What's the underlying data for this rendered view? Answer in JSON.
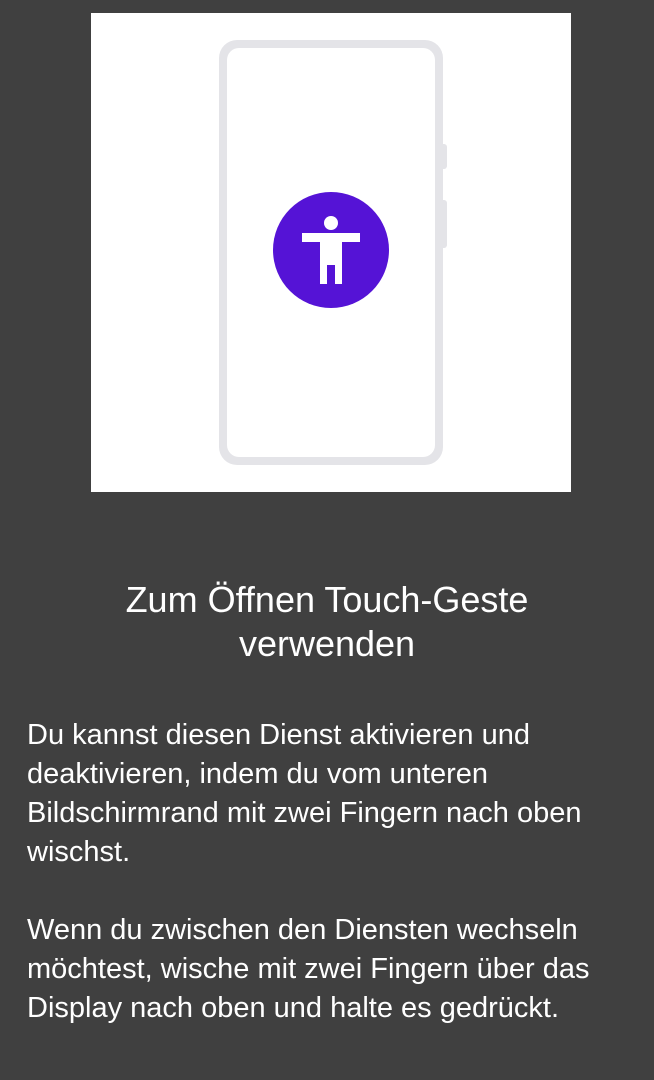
{
  "illustration": {
    "icon": "accessibility-icon",
    "accent_color": "#5513D6",
    "background_color": "#FFFFFF"
  },
  "dialog": {
    "title": "Zum Öffnen Touch-Geste verwenden",
    "paragraph_1": "Du kannst diesen Dienst aktivieren und deaktivieren, indem du vom unteren Bildschirmrand mit zwei Fingern nach oben wischst.",
    "paragraph_2": "Wenn du zwischen den Diensten wechseln möchtest, wische mit zwei Fingern über das Display nach oben und halte es gedrückt."
  }
}
